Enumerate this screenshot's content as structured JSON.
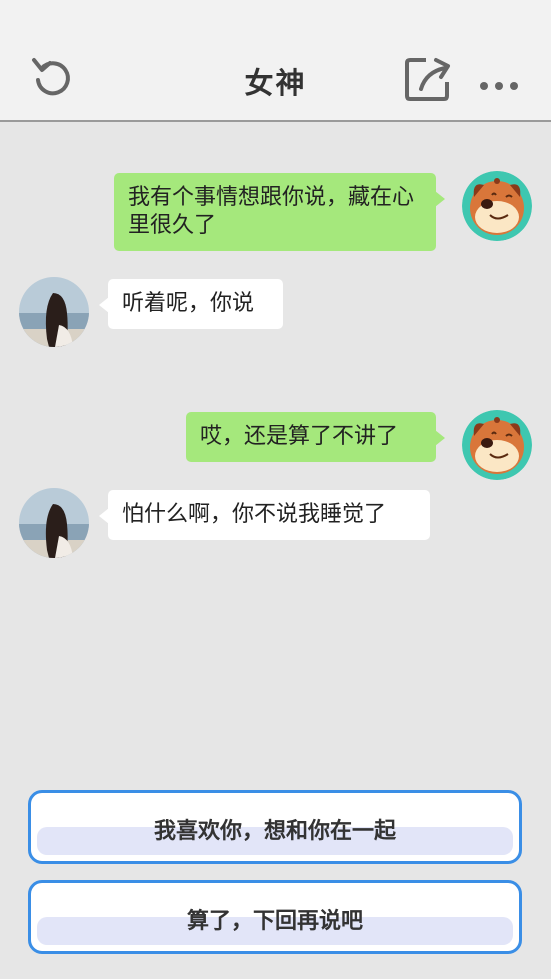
{
  "header": {
    "title": "女神"
  },
  "icons": {
    "back": "refresh-back-icon",
    "share": "share-icon",
    "more": "more-dots-icon"
  },
  "messages": [
    {
      "from": "me",
      "text": "我有个事情想跟你说，藏在心里很久了"
    },
    {
      "from": "her",
      "text": "听着呢，你说"
    },
    {
      "from": "me",
      "text": "哎，还是算了不讲了"
    },
    {
      "from": "her",
      "text": "怕什么啊，你不说我睡觉了"
    }
  ],
  "choices": [
    {
      "label": "我喜欢你，想和你在一起"
    },
    {
      "label": "算了，下回再说吧"
    }
  ],
  "colors": {
    "me_bubble": "#a5e87c",
    "her_bubble": "#ffffff",
    "choice_border": "#3a8ee6",
    "background": "#e6e6e6"
  }
}
